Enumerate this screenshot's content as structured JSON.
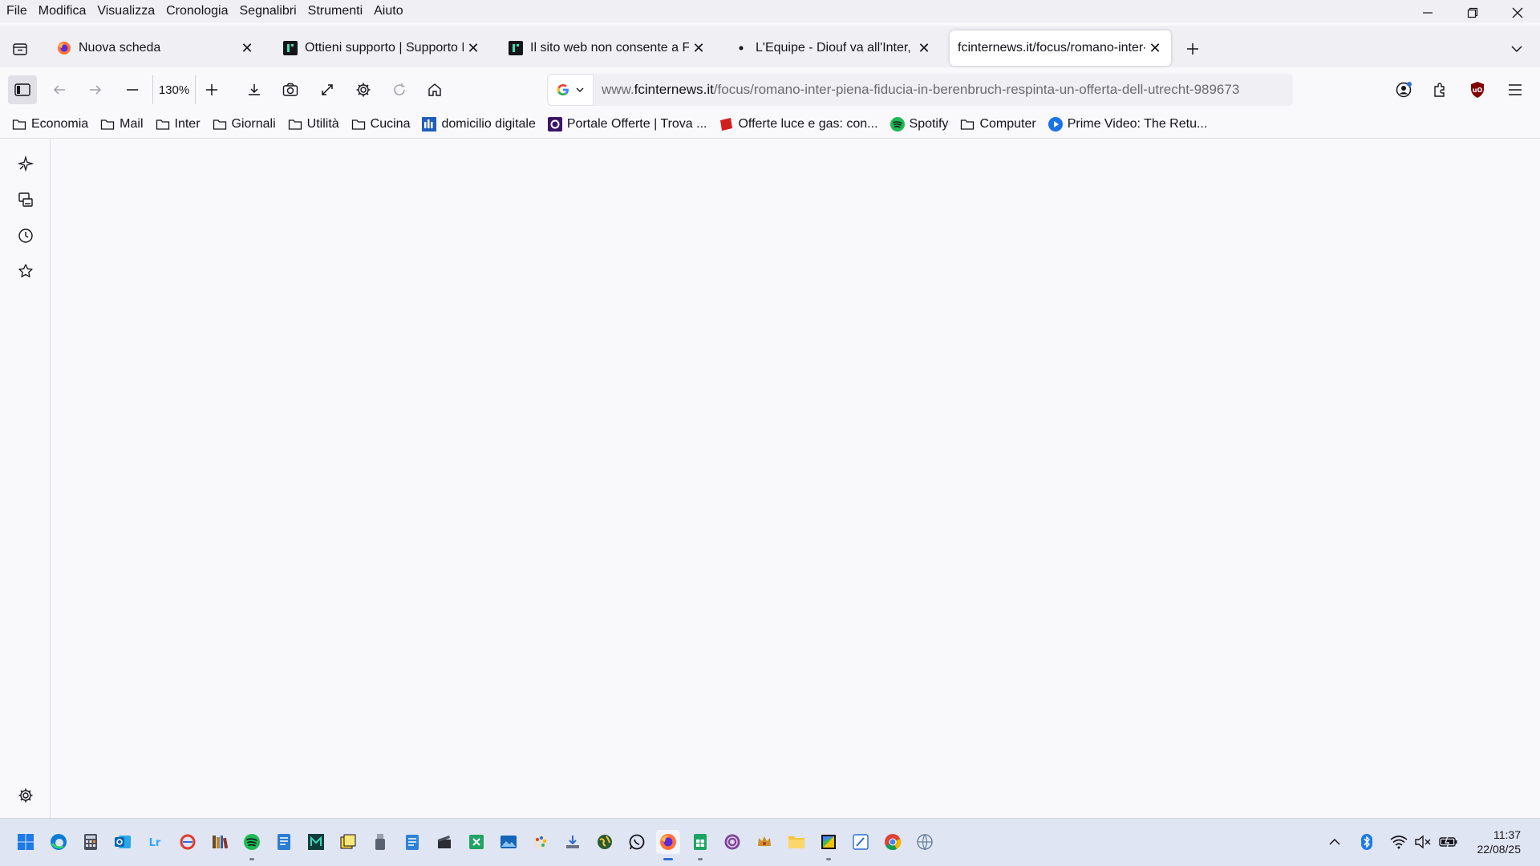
{
  "menu": [
    "File",
    "Modifica",
    "Visualizza",
    "Cronologia",
    "Segnalibri",
    "Strumenti",
    "Aiuto"
  ],
  "tabs": [
    {
      "title": "Nuova scheda",
      "favicon": "firefox-icon"
    },
    {
      "title": "Ottieni supporto | Supporto Mo",
      "favicon": "mozilla-support-icon"
    },
    {
      "title": "Il sito web non consente a Firefo",
      "favicon": "mozilla-support-icon"
    },
    {
      "title": "L'Equipe - Diouf va all'Inter, il Le",
      "favicon": "loading-dot-icon"
    },
    {
      "title": "fcinternews.it/focus/romano-inter-p",
      "favicon": "none",
      "active": true
    }
  ],
  "toolbar": {
    "zoom": "130%"
  },
  "url": {
    "prefix": "www.",
    "domain": "fcinternews.it",
    "path": "/focus/romano-inter-piena-fiducia-in-berenbruch-respinta-un-offerta-dell-utrecht-989673"
  },
  "bookmarks": [
    {
      "label": "Economia",
      "icon": "folder-icon"
    },
    {
      "label": "Mail",
      "icon": "folder-icon"
    },
    {
      "label": "Inter",
      "icon": "folder-icon"
    },
    {
      "label": "Giornali",
      "icon": "folder-icon"
    },
    {
      "label": "Utilità",
      "icon": "folder-icon"
    },
    {
      "label": "Cucina",
      "icon": "folder-icon"
    },
    {
      "label": "domicilio digitale",
      "icon": "domicilio-icon"
    },
    {
      "label": "Portale Offerte | Trova ...",
      "icon": "portale-offerte-icon"
    },
    {
      "label": "Offerte luce e gas: con...",
      "icon": "offerte-luce-icon"
    },
    {
      "label": "Spotify",
      "icon": "spotify-icon"
    },
    {
      "label": "Computer",
      "icon": "folder-icon"
    },
    {
      "label": "Prime Video: The Retu...",
      "icon": "prime-video-icon"
    }
  ],
  "clock": {
    "time": "11:37",
    "date": "22/08/25"
  },
  "colors": {
    "accent": "#2f6fd6",
    "spotify": "#1db954",
    "ublock": "#800000"
  }
}
